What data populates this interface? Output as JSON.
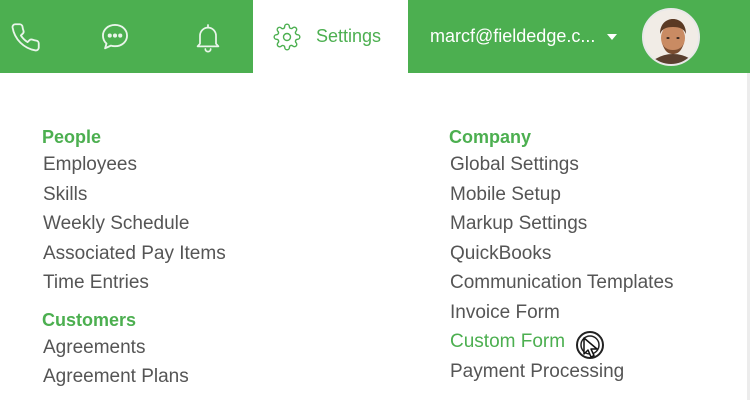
{
  "header": {
    "icons": [
      "phone-icon",
      "chat-icon",
      "bell-icon"
    ],
    "settings_tab": {
      "label": "Settings",
      "icon": "gear-icon"
    },
    "account": {
      "email": "marcf@fieldedge.c...",
      "caret": "chevron-down-icon"
    },
    "avatar": "avatar"
  },
  "colors": {
    "brand": "#4caf50",
    "text": "#555555",
    "header_text": "#ffffff"
  },
  "settings_menu": {
    "left": [
      {
        "title": "People",
        "items": [
          "Employees",
          "Skills",
          "Weekly Schedule",
          "Associated Pay Items",
          "Time Entries"
        ]
      },
      {
        "title": "Customers",
        "items": [
          "Agreements",
          "Agreement Plans"
        ]
      }
    ],
    "right": [
      {
        "title": "Company",
        "items": [
          "Global Settings",
          "Mobile Setup",
          "Markup Settings",
          "QuickBooks",
          "Communication Templates",
          "Invoice Form",
          "Custom Form",
          "Payment Processing"
        ],
        "active_item": "Custom Form"
      }
    ]
  }
}
